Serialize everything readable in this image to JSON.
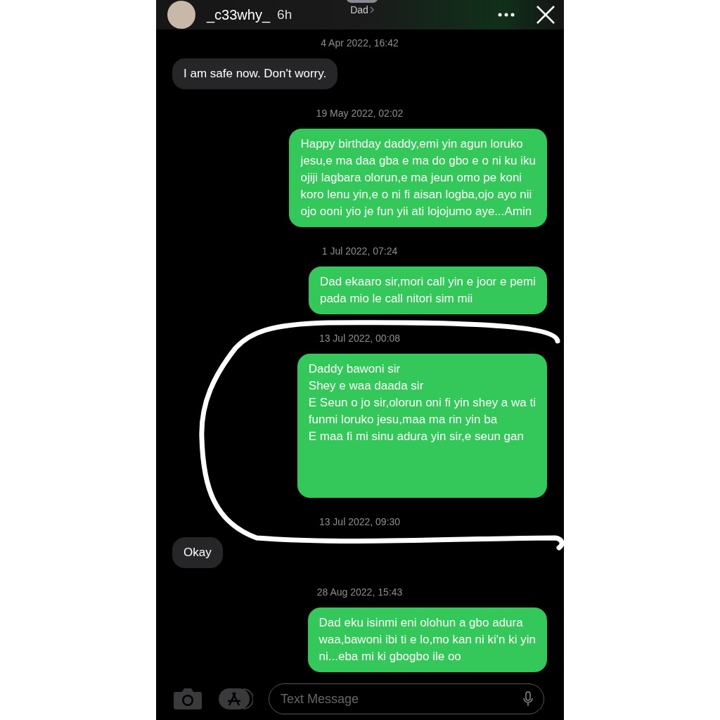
{
  "story_header": {
    "username": "_c33why_",
    "age": "6h",
    "contact": "Dad"
  },
  "thread": [
    {
      "kind": "timestamp",
      "text": "4 Apr 2022, 16:42"
    },
    {
      "kind": "received",
      "lines": [
        "I am safe now. Don't worry."
      ]
    },
    {
      "kind": "timestamp",
      "text": "19 May 2022, 02:02"
    },
    {
      "kind": "sent",
      "lines": [
        "Happy birthday daddy,emi yin agun loruko",
        "jesu,e ma daa gba e ma do gbo e o ni ku iku",
        "ojiji lagbara olorun,e ma jeun omo pe koni",
        "koro lenu yin,e o ni fi aisan logba,ojo ayo nii",
        "ojo ooni yio je fun yii ati lojojumo aye...Amin"
      ]
    },
    {
      "kind": "timestamp",
      "text": "1 Jul 2022, 07:24"
    },
    {
      "kind": "sent",
      "lines": [
        "Dad ekaaro sir,mori call yin e joor e pemi",
        "pada mio le call nitori sim mii"
      ]
    },
    {
      "kind": "timestamp",
      "text": "13 Jul 2022, 00:08"
    },
    {
      "kind": "sent",
      "circled": true,
      "lines": [
        "Daddy bawoni sir",
        "Shey e waa daada sir",
        "E Seun o jo sir,olorun oni fi yin shey a wa ti",
        "funmi loruko jesu,maa ma rin yin ba",
        "E maa fi mi sinu adura yin sir,e seun gan"
      ]
    },
    {
      "kind": "timestamp",
      "text": "13 Jul 2022, 09:30"
    },
    {
      "kind": "received",
      "lines": [
        "Okay"
      ]
    },
    {
      "kind": "timestamp",
      "text": "28 Aug 2022, 15:43"
    },
    {
      "kind": "sent",
      "lines": [
        "Dad eku isinmi eni olohun a gbo adura",
        "waa,bawoni ibi ti e lo,mo kan ni ki'n ki yin",
        "ni...eba mi ki gbogbo ile oo"
      ]
    }
  ],
  "composer": {
    "placeholder": "Text Message"
  }
}
